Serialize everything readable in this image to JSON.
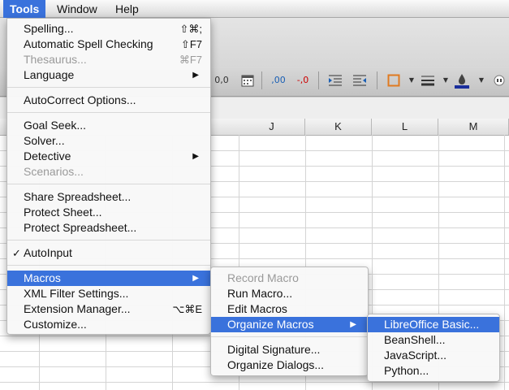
{
  "menubar": {
    "items": [
      "Tools",
      "Window",
      "Help"
    ]
  },
  "toolbar": {
    "icons": [
      "0,0",
      "calendar-icon",
      ",00",
      "-,0",
      "indent-icon",
      "outdent-icon",
      "border-icon",
      "line-style-icon",
      "color-icon"
    ]
  },
  "columns": [
    "J",
    "K",
    "L",
    "M"
  ],
  "tools_menu": {
    "items": [
      {
        "label": "Spelling...",
        "shortcut": "⇧⌘;",
        "disabled": false,
        "submenu": false
      },
      {
        "label": "Automatic Spell Checking",
        "shortcut": "⇧F7",
        "disabled": false,
        "submenu": false
      },
      {
        "label": "Thesaurus...",
        "shortcut": "⌘F7",
        "disabled": true,
        "submenu": false
      },
      {
        "label": "Language",
        "shortcut": "",
        "disabled": false,
        "submenu": true
      },
      {
        "label": "AutoCorrect Options...",
        "shortcut": "",
        "disabled": false,
        "submenu": false
      },
      {
        "label": "Goal Seek...",
        "shortcut": "",
        "disabled": false,
        "submenu": false
      },
      {
        "label": "Solver...",
        "shortcut": "",
        "disabled": false,
        "submenu": false
      },
      {
        "label": "Detective",
        "shortcut": "",
        "disabled": false,
        "submenu": true
      },
      {
        "label": "Scenarios...",
        "shortcut": "",
        "disabled": true,
        "submenu": false
      },
      {
        "label": "Share Spreadsheet...",
        "shortcut": "",
        "disabled": false,
        "submenu": false
      },
      {
        "label": "Protect Sheet...",
        "shortcut": "",
        "disabled": false,
        "submenu": false
      },
      {
        "label": "Protect Spreadsheet...",
        "shortcut": "",
        "disabled": false,
        "submenu": false
      },
      {
        "label": "AutoInput",
        "shortcut": "",
        "disabled": false,
        "submenu": false,
        "checked": true
      },
      {
        "label": "Macros",
        "shortcut": "",
        "disabled": false,
        "submenu": true,
        "highlighted": true
      },
      {
        "label": "XML Filter Settings...",
        "shortcut": "",
        "disabled": false,
        "submenu": false
      },
      {
        "label": "Extension Manager...",
        "shortcut": "⌥⌘E",
        "disabled": false,
        "submenu": false
      },
      {
        "label": "Customize...",
        "shortcut": "",
        "disabled": false,
        "submenu": false
      }
    ]
  },
  "macros_menu": {
    "items": [
      {
        "label": "Record Macro",
        "disabled": true
      },
      {
        "label": "Run Macro...",
        "disabled": false
      },
      {
        "label": "Edit Macros",
        "disabled": false
      },
      {
        "label": "Organize Macros",
        "disabled": false,
        "submenu": true,
        "highlighted": true
      },
      {
        "label": "Digital Signature...",
        "disabled": false
      },
      {
        "label": "Organize Dialogs...",
        "disabled": false
      }
    ]
  },
  "organize_menu": {
    "items": [
      {
        "label": "LibreOffice Basic...",
        "highlighted": true
      },
      {
        "label": "BeanShell..."
      },
      {
        "label": "JavaScript..."
      },
      {
        "label": "Python..."
      }
    ]
  },
  "colors": {
    "accent": "#3a72dc",
    "border_icon": "#e07a20",
    "color_icon": "#1a2e9c"
  }
}
